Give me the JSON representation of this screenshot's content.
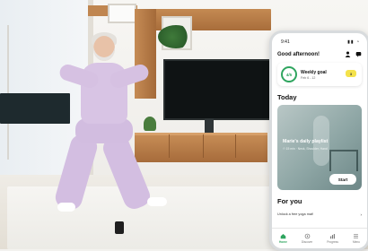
{
  "phone": {
    "status": {
      "time": "9:41",
      "icons": "▮▮ ◔"
    },
    "greeting": "Good afternoon!",
    "weekly_goal": {
      "progress_text": "4/5",
      "title": "Weekly goal",
      "subtitle": "Feb 6 - 12",
      "badge": "3"
    },
    "today_title": "Today",
    "playlist": {
      "title": "Marie's daily playlist",
      "meta": "⏱ 15 min · Neck, Shoulder, Hand",
      "start_label": "Start"
    },
    "for_you_title": "For you",
    "promo_text": "Unlock a free yoga mat!",
    "tabs": [
      {
        "label": "Home",
        "active": true
      },
      {
        "label": "Discover",
        "active": false
      },
      {
        "label": "Progress",
        "active": false
      },
      {
        "label": "Menu",
        "active": false
      }
    ],
    "colors": {
      "accent": "#2fa55f",
      "badge": "#f4e24b"
    }
  },
  "icons": [
    "person-icon",
    "chat-icon",
    "home-icon",
    "discover-icon",
    "progress-icon",
    "menu-icon",
    "arrow-right-icon"
  ]
}
